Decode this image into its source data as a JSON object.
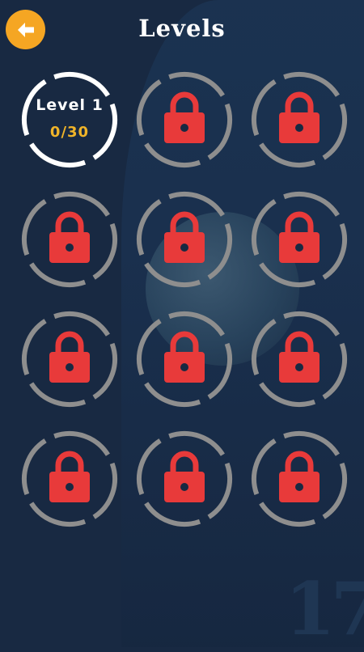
{
  "header": {
    "title": "Levels",
    "back_icon": "arrow-left-icon"
  },
  "colors": {
    "background": "#182942",
    "accent": "#f5a623",
    "lock": "#e83a3a",
    "ring_locked": "#8e8e8e",
    "ring_unlocked": "#ffffff",
    "progress_text": "#f0b429"
  },
  "levels": [
    {
      "name": "Level 1",
      "progress": "0/30",
      "locked": false
    },
    {
      "locked": true,
      "icon": "lock-icon"
    },
    {
      "locked": true,
      "icon": "lock-icon"
    },
    {
      "locked": true,
      "icon": "lock-icon"
    },
    {
      "locked": true,
      "icon": "lock-icon"
    },
    {
      "locked": true,
      "icon": "lock-icon"
    },
    {
      "locked": true,
      "icon": "lock-icon"
    },
    {
      "locked": true,
      "icon": "lock-icon"
    },
    {
      "locked": true,
      "icon": "lock-icon"
    },
    {
      "locked": true,
      "icon": "lock-icon"
    },
    {
      "locked": true,
      "icon": "lock-icon"
    },
    {
      "locked": true,
      "icon": "lock-icon"
    }
  ]
}
